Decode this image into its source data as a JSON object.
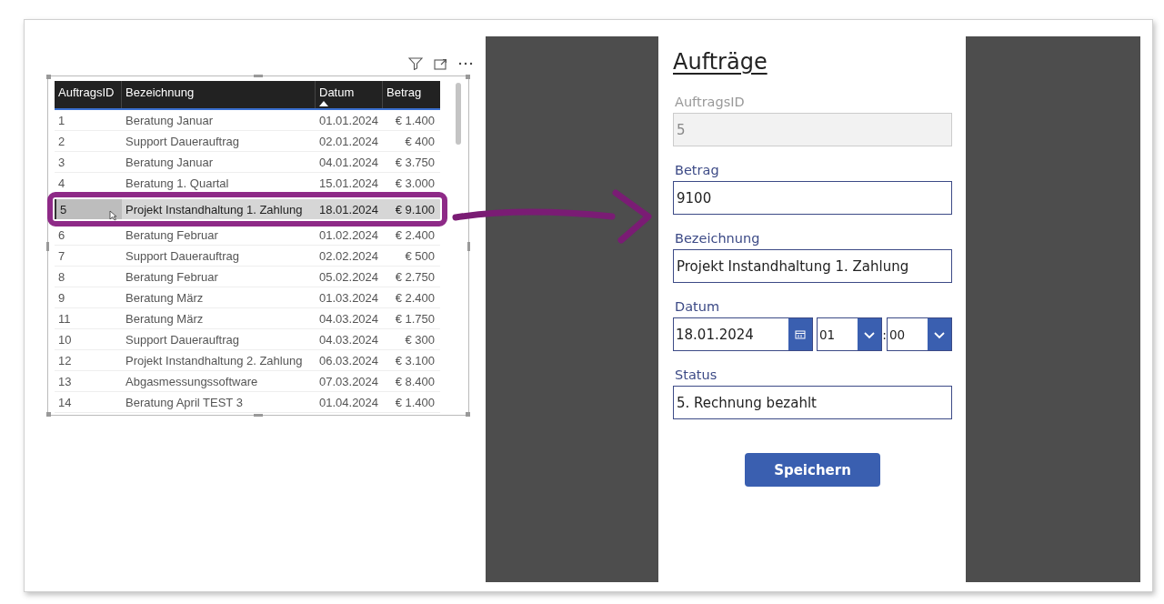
{
  "table": {
    "columns": [
      {
        "label": "AuftragsID",
        "sorted": false
      },
      {
        "label": "Bezeichnung",
        "sorted": false
      },
      {
        "label": "Datum",
        "sorted": true
      },
      {
        "label": "Betrag",
        "sorted": false
      }
    ],
    "rows": [
      {
        "cells": [
          "1",
          "Beratung Januar",
          "01.01.2024",
          "€ 1.400"
        ],
        "selected": false
      },
      {
        "cells": [
          "2",
          "Support Dauerauftrag",
          "02.01.2024",
          "€ 400"
        ],
        "selected": false
      },
      {
        "cells": [
          "3",
          "Beratung Januar",
          "04.01.2024",
          "€ 3.750"
        ],
        "selected": false
      },
      {
        "cells": [
          "4",
          "Beratung 1. Quartal",
          "15.01.2024",
          "€ 3.000"
        ],
        "selected": false
      },
      {
        "cells": [
          "5",
          "Projekt Instandhaltung 1. Zahlung",
          "18.01.2024",
          "€ 9.100"
        ],
        "selected": true
      },
      {
        "cells": [
          "6",
          "Beratung Februar",
          "01.02.2024",
          "€ 2.400"
        ],
        "selected": false
      },
      {
        "cells": [
          "7",
          "Support Dauerauftrag",
          "02.02.2024",
          "€ 500"
        ],
        "selected": false
      },
      {
        "cells": [
          "8",
          "Beratung Februar",
          "05.02.2024",
          "€ 2.750"
        ],
        "selected": false
      },
      {
        "cells": [
          "9",
          "Beratung März",
          "01.03.2024",
          "€ 2.400"
        ],
        "selected": false
      },
      {
        "cells": [
          "11",
          "Beratung März",
          "04.03.2024",
          "€ 1.750"
        ],
        "selected": false
      },
      {
        "cells": [
          "10",
          "Support Dauerauftrag",
          "04.03.2024",
          "€ 300"
        ],
        "selected": false
      },
      {
        "cells": [
          "12",
          "Projekt Instandhaltung 2. Zahlung",
          "06.03.2024",
          "€ 3.100"
        ],
        "selected": false
      },
      {
        "cells": [
          "13",
          "Abgasmessungssoftware",
          "07.03.2024",
          "€ 8.400"
        ],
        "selected": false
      },
      {
        "cells": [
          "14",
          "Beratung April TEST 3",
          "01.04.2024",
          "€ 1.400"
        ],
        "selected": false
      }
    ]
  },
  "form": {
    "title": "Aufträge",
    "fields": [
      {
        "kind": "text",
        "label": "AuftragsID",
        "value": "5",
        "disabled": true
      },
      {
        "kind": "text",
        "label": "Betrag",
        "value": "9100",
        "disabled": false
      },
      {
        "kind": "text",
        "label": "Bezeichnung",
        "value": "Projekt Instandhaltung 1. Zahlung",
        "disabled": false
      },
      {
        "kind": "datetime",
        "label": "Datum",
        "value": "18.01.2024",
        "hour": "01",
        "separator": ":",
        "minute": "00",
        "disabled": false
      },
      {
        "kind": "text",
        "label": "Status",
        "value": "5. Rechnung bezahlt",
        "disabled": false
      }
    ],
    "button": "Speichern"
  }
}
